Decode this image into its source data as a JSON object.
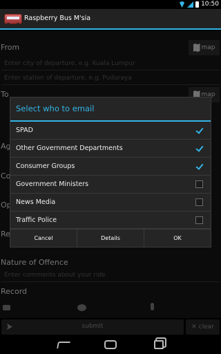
{
  "status_bar": {
    "time": "10:50"
  },
  "action_bar": {
    "title": "Raspberry Bus M'sia"
  },
  "form": {
    "from_label": "From",
    "from_city_placeholder": "Enter city of departure, e.g. Kuala Lumpur",
    "from_station_placeholder": "Enter station of departure, e.g. Puduraya",
    "map_label": "map",
    "to_label": "To",
    "partial_labels": [
      "Ag",
      "Co",
      "Op",
      "Re"
    ],
    "nature_label": "Nature of Offence",
    "nature_placeholder": "Enter comments about your ride",
    "record_label": "Record",
    "submit_label": "submit",
    "clear_label": "clear"
  },
  "dialog": {
    "title": "Select who to email",
    "options": [
      {
        "label": "SPAD",
        "checked": true
      },
      {
        "label": "Other Government Departments",
        "checked": true
      },
      {
        "label": "Consumer Groups",
        "checked": true
      },
      {
        "label": "Government Ministers",
        "checked": false
      },
      {
        "label": "News Media",
        "checked": false
      },
      {
        "label": "Traffic Police",
        "checked": false
      }
    ],
    "buttons": {
      "cancel": "Cancel",
      "details": "Details",
      "ok": "OK"
    }
  },
  "colors": {
    "accent": "#33b5e5",
    "dialog_bg": "#252525",
    "background": "#141414"
  }
}
